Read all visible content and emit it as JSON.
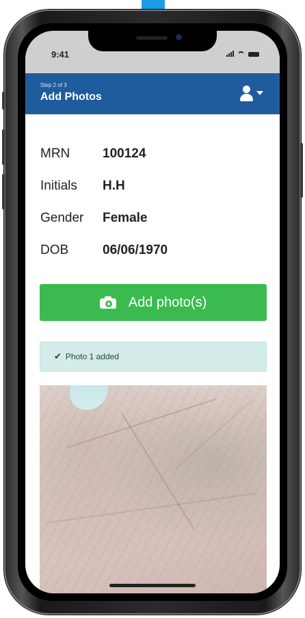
{
  "status_bar": {
    "time": "9:41"
  },
  "header": {
    "step": "Step 2 of 3",
    "title": "Add Photos",
    "bg_color": "#1f5c9e"
  },
  "patient": {
    "fields": [
      {
        "label": "MRN",
        "value": "100124"
      },
      {
        "label": "Initials",
        "value": "H.H"
      },
      {
        "label": "Gender",
        "value": "Female"
      },
      {
        "label": "DOB",
        "value": "06/06/1970"
      }
    ]
  },
  "add_photo_button": {
    "label": "Add photo(s)",
    "icon": "camera-icon",
    "color": "#3bbb4f"
  },
  "alert": {
    "icon": "checkmark-icon",
    "text": "Photo 1 added",
    "bg_color": "#d3ece9"
  },
  "photo": {
    "description_icon": "uploaded-photo"
  }
}
